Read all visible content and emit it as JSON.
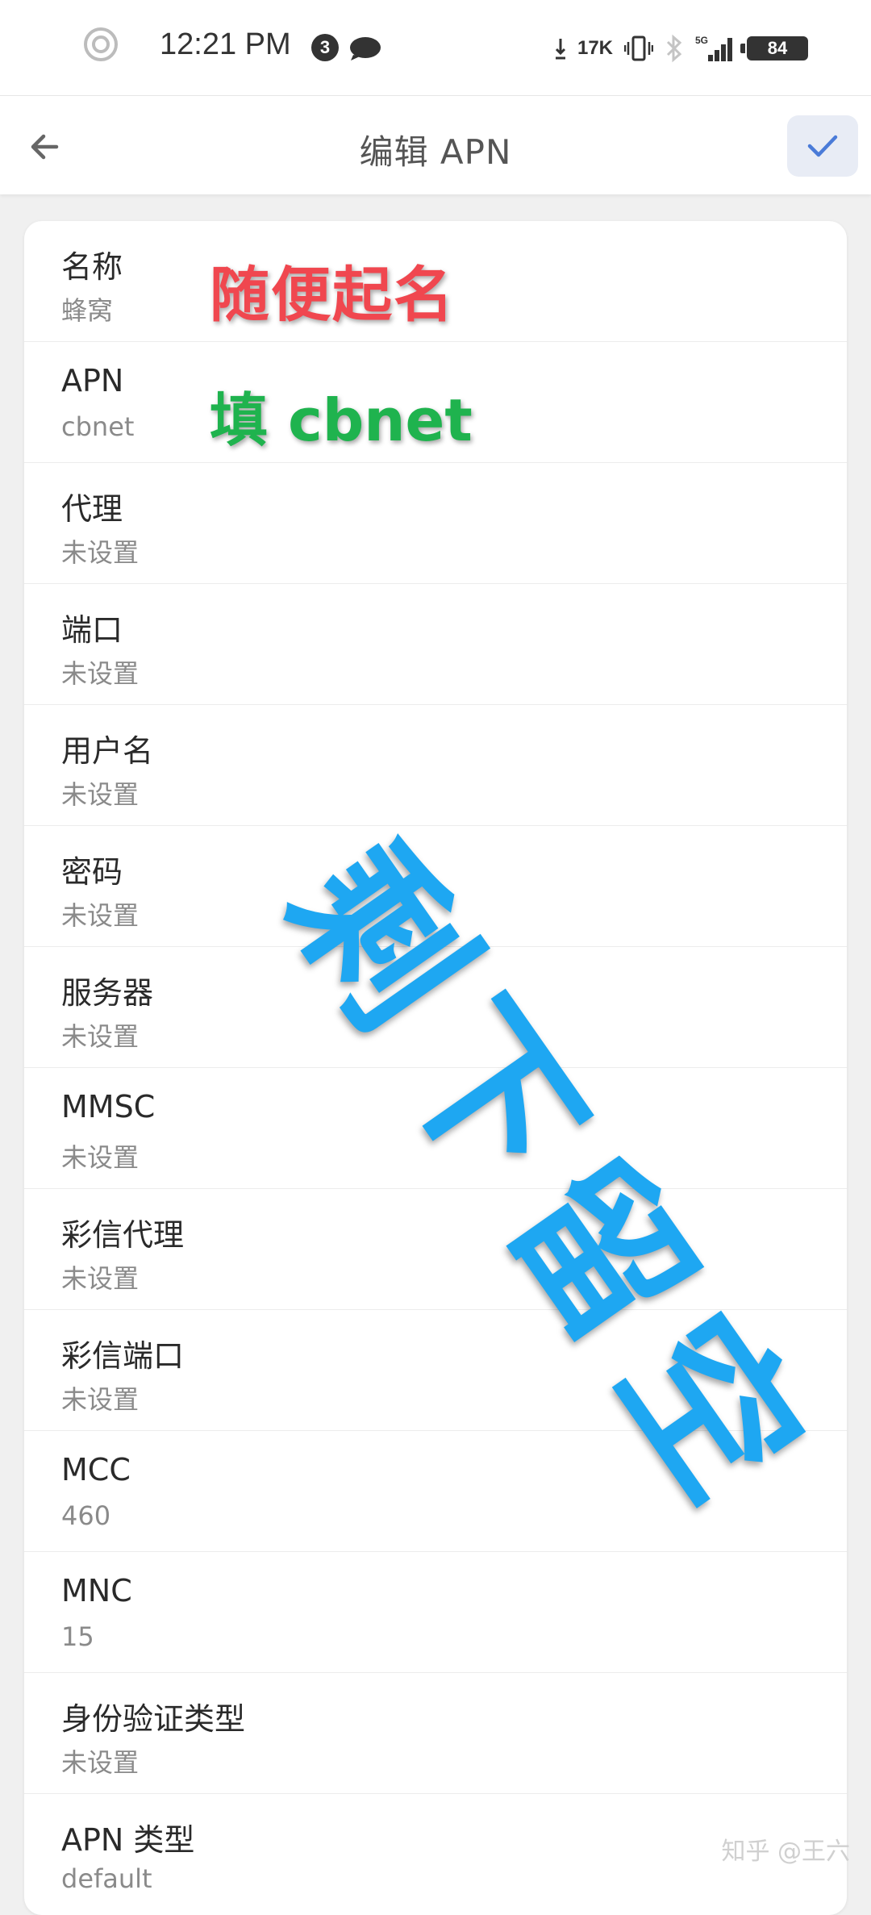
{
  "status_bar": {
    "time": "12:21 PM",
    "notification_count": "3",
    "net_speed": "17K",
    "network": "5G",
    "battery": "84"
  },
  "app_bar": {
    "title": "编辑 APN"
  },
  "rows": [
    {
      "label": "名称",
      "value": "蜂窝"
    },
    {
      "label": "APN",
      "value": "cbnet"
    },
    {
      "label": "代理",
      "value": "未设置"
    },
    {
      "label": "端口",
      "value": "未设置"
    },
    {
      "label": "用户名",
      "value": "未设置"
    },
    {
      "label": "密码",
      "value": "未设置"
    },
    {
      "label": "服务器",
      "value": "未设置"
    },
    {
      "label": "MMSC",
      "value": "未设置"
    },
    {
      "label": "彩信代理",
      "value": "未设置"
    },
    {
      "label": "彩信端口",
      "value": "未设置"
    },
    {
      "label": "MCC",
      "value": "460"
    },
    {
      "label": "MNC",
      "value": "15"
    },
    {
      "label": "身份验证类型",
      "value": "未设置"
    },
    {
      "label": "APN 类型",
      "value": "default"
    }
  ],
  "annotations": {
    "name_hint": "随便起名",
    "apn_hint": "填 cbnet",
    "rest_hint": "剩下留空"
  },
  "watermark": "知乎 @王六",
  "colors": {
    "annotation_red": "#f0474f",
    "annotation_green": "#1fb34e",
    "annotation_blue": "#1ea7f2",
    "confirm_accent": "#4a7bd8"
  }
}
